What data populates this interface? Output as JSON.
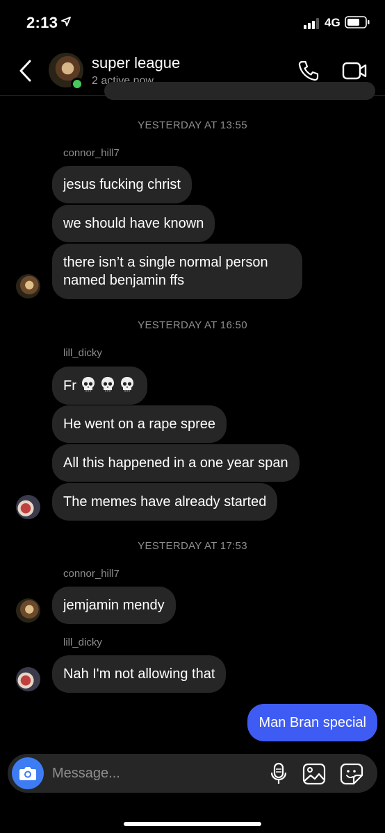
{
  "status_bar": {
    "time": "2:13",
    "network": "4G"
  },
  "header": {
    "title": "super league",
    "subtitle": "2 active now"
  },
  "timestamps": [
    "YESTERDAY AT 13:55",
    "YESTERDAY AT 16:50",
    "YESTERDAY AT 17:53"
  ],
  "messages": [
    {
      "sender": "connor_hill7",
      "text": "jesus fucking christ"
    },
    {
      "sender": "connor_hill7",
      "text": "we should have known"
    },
    {
      "sender": "connor_hill7",
      "text": "there isn’t a single normal person named benjamin ffs"
    },
    {
      "sender": "lill_dicky",
      "text": "Fr",
      "emoji": "skull-icon x3"
    },
    {
      "sender": "lill_dicky",
      "text": "He went on a rape spree"
    },
    {
      "sender": "lill_dicky",
      "text": "All this happened in a one year span"
    },
    {
      "sender": "lill_dicky",
      "text": "The memes have already started"
    },
    {
      "sender": "connor_hill7",
      "text": "jemjamin mendy"
    },
    {
      "sender": "lill_dicky",
      "text": "Nah I'm not allowing that"
    },
    {
      "sender": "me",
      "text": "Man Bran special"
    }
  ],
  "composer": {
    "placeholder": "Message..."
  },
  "colors": {
    "bubble_other": "#262626",
    "bubble_me": "#3e5cf3",
    "online": "#47c95a",
    "camera": "#3e7cf3"
  }
}
